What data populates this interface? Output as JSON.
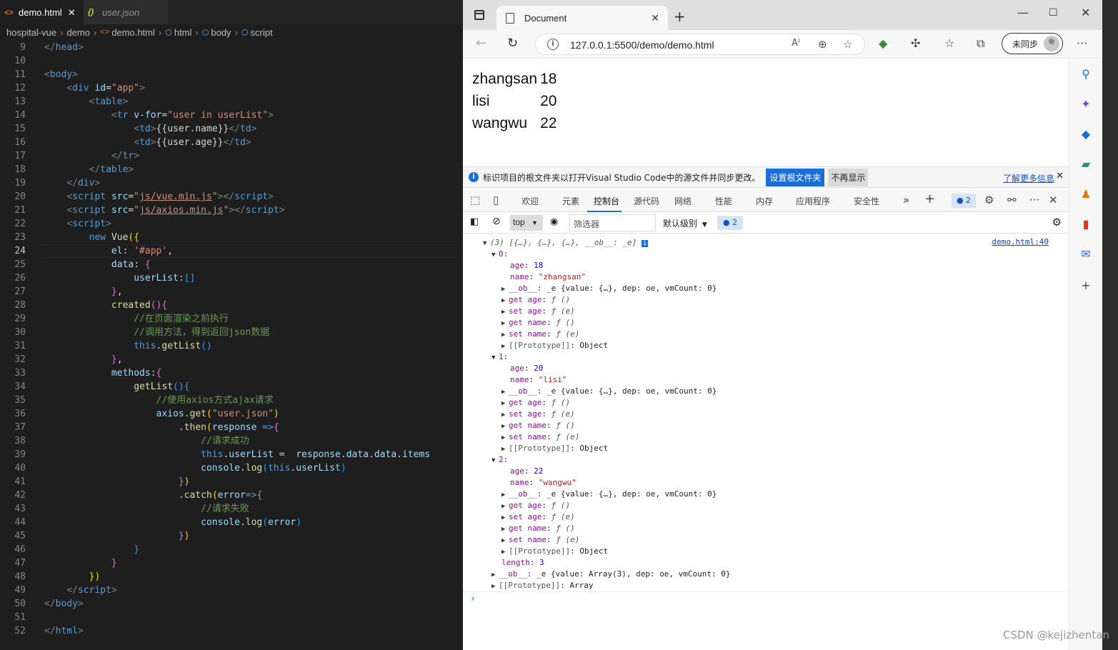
{
  "editor": {
    "tabs": [
      {
        "label": "demo.html",
        "icon": "html-icon",
        "active": true
      },
      {
        "label": "user.json",
        "icon": "json-icon",
        "active": false
      }
    ],
    "breadcrumb": [
      "hospital-vue",
      "demo",
      "demo.html",
      "html",
      "body",
      "script"
    ],
    "current_line": 24
  },
  "browser": {
    "tab_title": "Document",
    "url": "127.0.0.1:5500/demo/demo.html",
    "sync_label": "未同步",
    "page_rows": [
      {
        "name": "zhangsan",
        "age": "18"
      },
      {
        "name": "lisi",
        "age": "20"
      },
      {
        "name": "wangwu",
        "age": "22"
      }
    ],
    "infobar": {
      "message": "标识项目的根文件夹以打开Visual Studio Code中的源文件并同步更改。",
      "primary_button": "设置根文件夹",
      "secondary_button": "不再显示",
      "link": "了解更多信息"
    },
    "devtools_tabs": [
      "欢迎",
      "元素",
      "控制台",
      "源代码",
      "网络",
      "性能",
      "内存",
      "应用程序",
      "安全性"
    ],
    "devtools_selected": "控制台",
    "issues_count": "2",
    "context": "top",
    "filter_placeholder": "筛选器",
    "level_label": "默认级别",
    "message_count": "2",
    "source_link": "demo.html:40"
  },
  "watermark": "CSDN @kejizhentan",
  "colors": {
    "accent": "#1a6ed8",
    "editor_bg": "#1e1e1e",
    "string": "#ce9178",
    "keyword": "#569cd6"
  }
}
